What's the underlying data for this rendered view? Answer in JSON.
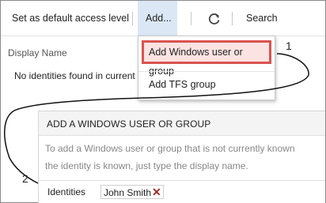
{
  "toolbar": {
    "default_access": "Set as default access level",
    "add_label": "Add...",
    "search_label": "Search"
  },
  "list": {
    "column_header": "Display Name",
    "empty_message": "No identities found in current"
  },
  "add_menu": {
    "items": [
      {
        "label": "Add Windows user or group"
      },
      {
        "label": "Add TFS group"
      }
    ]
  },
  "callouts": {
    "one": "1",
    "two": "2"
  },
  "dialog": {
    "title": "ADD A WINDOWS USER OR GROUP",
    "description_line1": "To add a Windows user or group that is not currently known",
    "description_line2": "the identity is known, just type the display name.",
    "identities_label": "Identities",
    "identity_chip": "John Smith"
  },
  "colors": {
    "highlight_border": "#d9534f",
    "add_button_bg": "#dbe7f5",
    "remove_x": "#a02a2a"
  }
}
